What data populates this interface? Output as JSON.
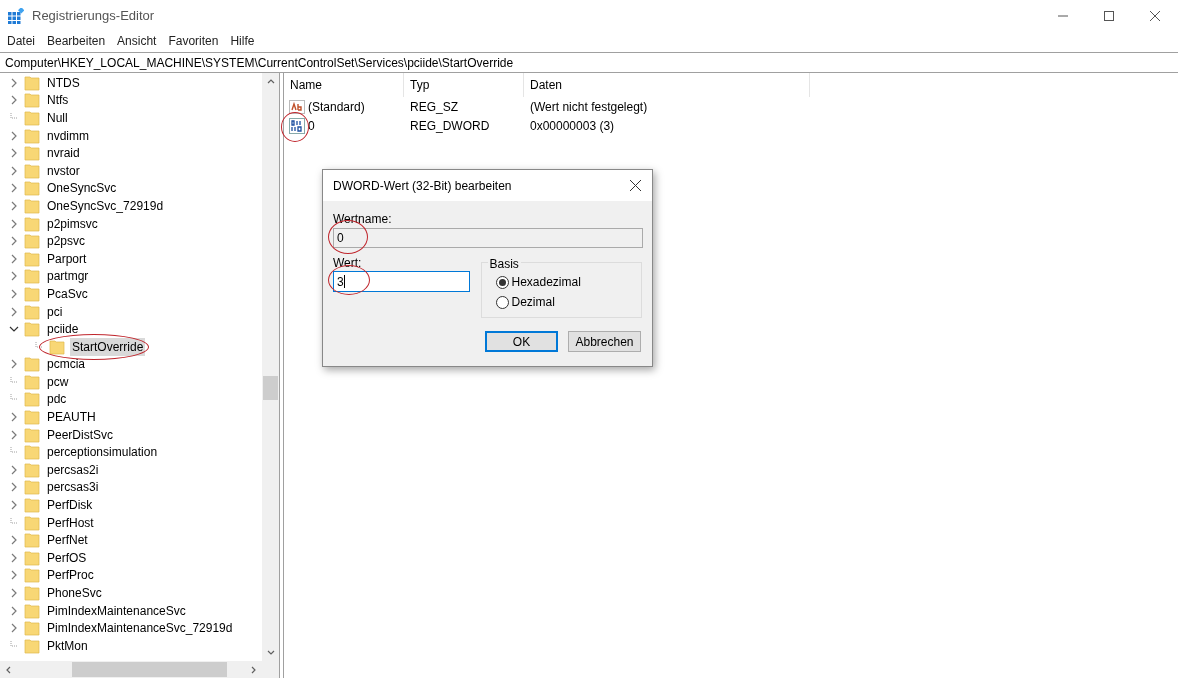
{
  "window": {
    "title": "Registrierungs-Editor"
  },
  "menu": [
    "Datei",
    "Bearbeiten",
    "Ansicht",
    "Favoriten",
    "Hilfe"
  ],
  "address": "Computer\\HKEY_LOCAL_MACHINE\\SYSTEM\\CurrentControlSet\\Services\\pciide\\StartOverride",
  "tree": [
    {
      "label": "NTDS",
      "kind": "collapsed"
    },
    {
      "label": "Ntfs",
      "kind": "collapsed"
    },
    {
      "label": "Null",
      "kind": "leaf"
    },
    {
      "label": "nvdimm",
      "kind": "collapsed"
    },
    {
      "label": "nvraid",
      "kind": "collapsed"
    },
    {
      "label": "nvstor",
      "kind": "collapsed"
    },
    {
      "label": "OneSyncSvc",
      "kind": "collapsed"
    },
    {
      "label": "OneSyncSvc_72919d",
      "kind": "collapsed"
    },
    {
      "label": "p2pimsvc",
      "kind": "collapsed"
    },
    {
      "label": "p2psvc",
      "kind": "collapsed"
    },
    {
      "label": "Parport",
      "kind": "collapsed"
    },
    {
      "label": "partmgr",
      "kind": "collapsed"
    },
    {
      "label": "PcaSvc",
      "kind": "collapsed"
    },
    {
      "label": "pci",
      "kind": "collapsed"
    },
    {
      "label": "pciide",
      "kind": "expanded",
      "children": [
        {
          "label": "StartOverride",
          "kind": "leaf",
          "selected": true,
          "circled": true
        }
      ]
    },
    {
      "label": "pcmcia",
      "kind": "collapsed"
    },
    {
      "label": "pcw",
      "kind": "leaf"
    },
    {
      "label": "pdc",
      "kind": "leaf"
    },
    {
      "label": "PEAUTH",
      "kind": "collapsed"
    },
    {
      "label": "PeerDistSvc",
      "kind": "collapsed"
    },
    {
      "label": "perceptionsimulation",
      "kind": "leaf"
    },
    {
      "label": "percsas2i",
      "kind": "collapsed"
    },
    {
      "label": "percsas3i",
      "kind": "collapsed"
    },
    {
      "label": "PerfDisk",
      "kind": "collapsed"
    },
    {
      "label": "PerfHost",
      "kind": "leaf"
    },
    {
      "label": "PerfNet",
      "kind": "collapsed"
    },
    {
      "label": "PerfOS",
      "kind": "collapsed"
    },
    {
      "label": "PerfProc",
      "kind": "collapsed"
    },
    {
      "label": "PhoneSvc",
      "kind": "collapsed"
    },
    {
      "label": "PimIndexMaintenanceSvc",
      "kind": "collapsed"
    },
    {
      "label": "PimIndexMaintenanceSvc_72919d",
      "kind": "collapsed"
    },
    {
      "label": "PktMon",
      "kind": "leaf"
    }
  ],
  "values": {
    "columns": [
      "Name",
      "Typ",
      "Daten"
    ],
    "rows": [
      {
        "name": "(Standard)",
        "type": "REG_SZ",
        "data": "(Wert nicht festgelegt)",
        "kind": "string",
        "circled": false
      },
      {
        "name": "0",
        "type": "REG_DWORD",
        "data": "0x00000003 (3)",
        "kind": "binary",
        "circled": true
      }
    ]
  },
  "dialog": {
    "title": "DWORD-Wert (32-Bit) bearbeiten",
    "name_label": "Wertname:",
    "name_value": "0",
    "name_circled": true,
    "value_label": "Wert:",
    "value": "3",
    "value_circled": true,
    "base_label": "Basis",
    "bases": [
      {
        "label": "Hexadezimal",
        "selected": true
      },
      {
        "label": "Dezimal",
        "selected": false
      }
    ],
    "buttons": [
      "OK",
      "Abbrechen"
    ]
  }
}
